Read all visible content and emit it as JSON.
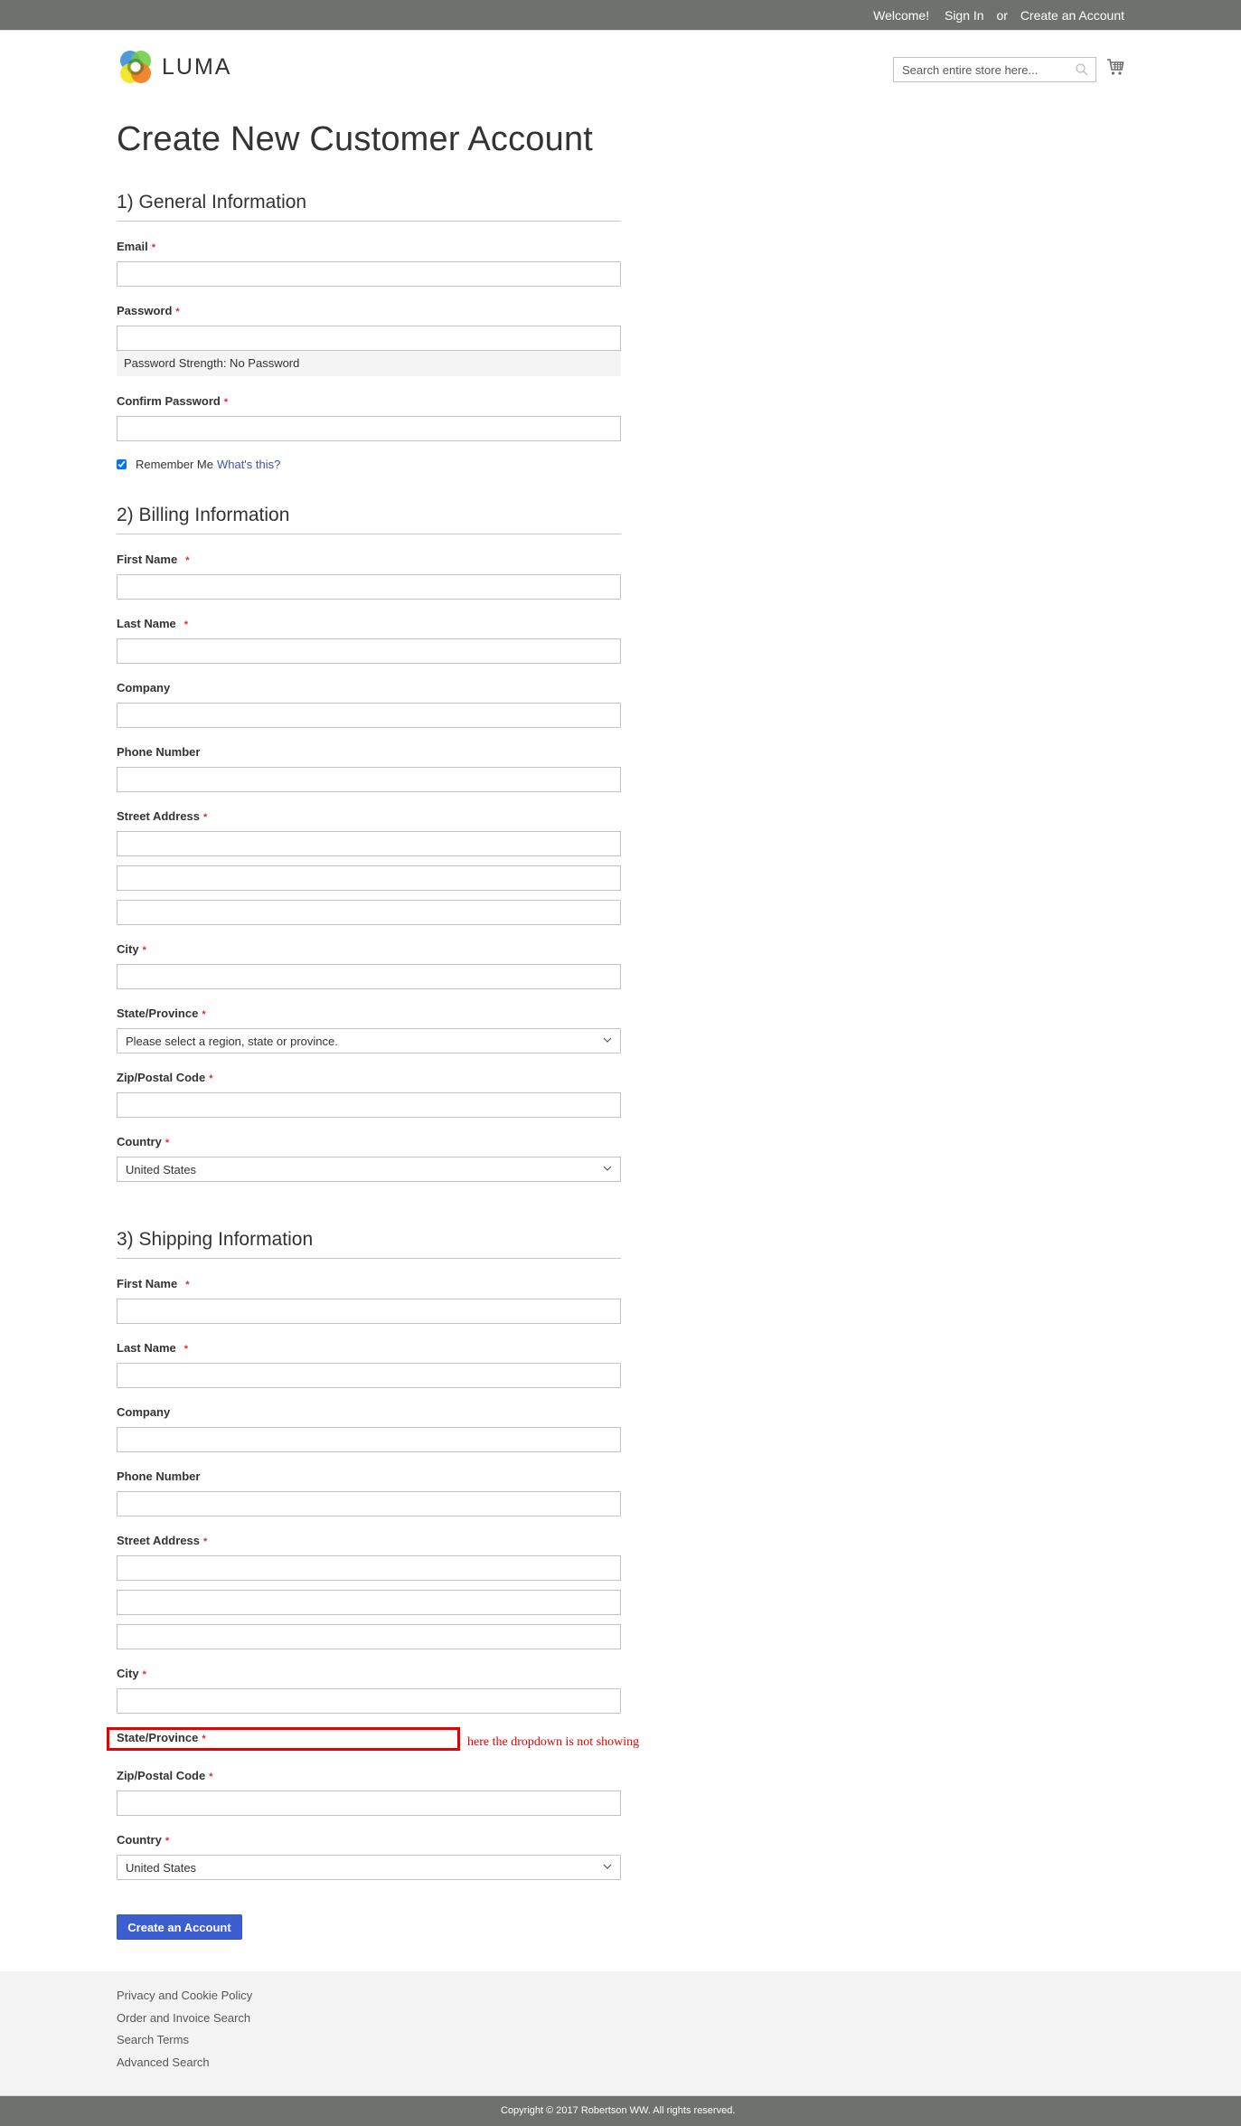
{
  "header": {
    "welcome": "Welcome!",
    "sign_in": "Sign In",
    "or": "or",
    "create_account": "Create an Account",
    "logo_text": "LUMA",
    "search_placeholder": "Search entire store here...",
    "search_value": ""
  },
  "page": {
    "title": "Create New Customer Account"
  },
  "general": {
    "title": "1) General Information",
    "email_label": "Email",
    "email_value": "",
    "password_label": "Password",
    "password_value": "",
    "password_strength": "Password Strength: No Password",
    "confirm_password_label": "Confirm Password",
    "confirm_password_value": "",
    "remember_me_label": "Remember Me",
    "remember_me_checked": true,
    "whats_this": "What's this?"
  },
  "billing": {
    "title": "2) Billing Information",
    "first_name_label": "First Name",
    "last_name_label": "Last Name",
    "company_label": "Company",
    "phone_label": "Phone Number",
    "street_label": "Street Address",
    "city_label": "City",
    "state_label": "State/Province",
    "state_selected": "Please select a region, state or province.",
    "zip_label": "Zip/Postal Code",
    "country_label": "Country",
    "country_selected": "United States"
  },
  "shipping": {
    "title": "3) Shipping Information",
    "first_name_label": "First Name",
    "last_name_label": "Last Name",
    "company_label": "Company",
    "phone_label": "Phone Number",
    "street_label": "Street Address",
    "city_label": "City",
    "state_label": "State/Province",
    "zip_label": "Zip/Postal Code",
    "country_label": "Country",
    "country_selected": "United States"
  },
  "required_marker": "*",
  "annotation": {
    "text": "here the dropdown is not showing",
    "color": "#e60000"
  },
  "submit": {
    "label": "Create an Account",
    "color": "#3d5ed0"
  },
  "footer": {
    "links": [
      "Privacy and Cookie Policy",
      "Order and Invoice Search",
      "Search Terms",
      "Advanced Search"
    ],
    "copyright": "Copyright © 2017 Robertson WW. All rights reserved."
  }
}
